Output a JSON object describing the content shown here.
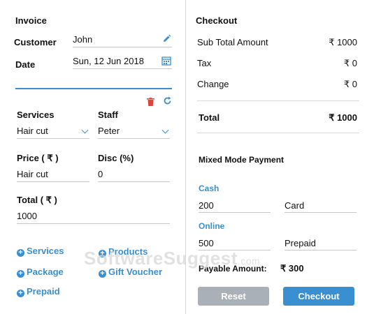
{
  "invoice": {
    "title": "Invoice",
    "customer_label": "Customer",
    "customer_value": "John",
    "date_label": "Date",
    "date_value": "Sun, 12 Jun 2018"
  },
  "item": {
    "services_label": "Services",
    "services_value": "Hair cut",
    "staff_label": "Staff",
    "staff_value": "Peter",
    "price_label": "Price ( ₹ )",
    "price_value": "Hair cut",
    "disc_label": "Disc (%)",
    "disc_value": "0",
    "total_label": "Total ( ₹ )",
    "total_value": "1000"
  },
  "add_links": {
    "services": "Services",
    "products": "Products",
    "package": "Package",
    "gift_voucher": "Gift Voucher",
    "prepaid": "Prepaid"
  },
  "checkout": {
    "title": "Checkout",
    "subtotal_label": "Sub Total Amount",
    "subtotal_value": "₹ 1000",
    "tax_label": "Tax",
    "tax_value": "₹ 0",
    "change_label": "Change",
    "change_value": "₹ 0",
    "total_label": "Total",
    "total_value": "₹ 1000"
  },
  "payment": {
    "title": "Mixed Mode Payment",
    "cash_label": "Cash",
    "cash_amount": "200",
    "cash_method": "Card",
    "online_label": "Online",
    "online_amount": "500",
    "online_method": "Prepaid",
    "payable_label": "Payable Amount:",
    "payable_value": "₹ 300"
  },
  "buttons": {
    "reset": "Reset",
    "checkout": "Checkout"
  },
  "watermark": {
    "brand": "SoftwareSuggest",
    "suffix": ".com"
  },
  "colors": {
    "accent": "#3a8fd0",
    "delete": "#e0443a",
    "reset_btn": "#a9b0b8",
    "checkout_btn": "#3a8fd0"
  }
}
